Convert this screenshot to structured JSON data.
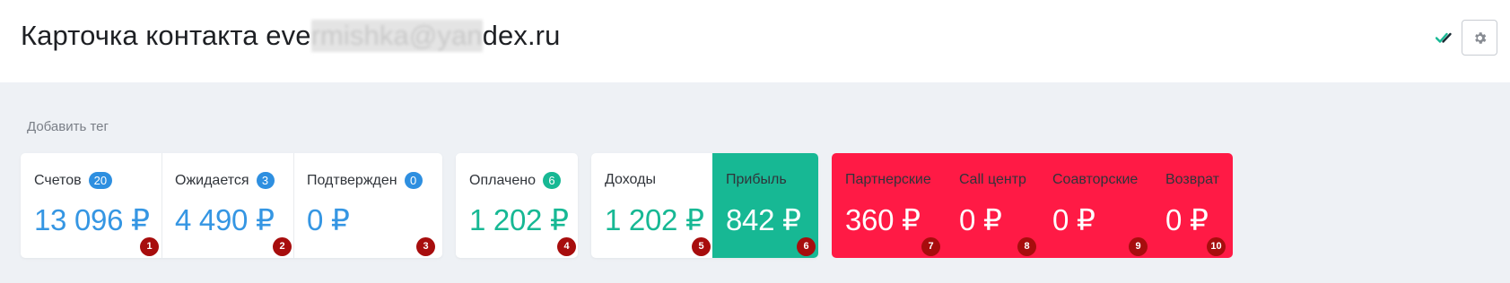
{
  "header": {
    "title_prefix": "Карточка контакта eve",
    "title_masked": "rmishka@yan",
    "title_suffix": "dex.ru",
    "status_icon": "check-double-icon",
    "settings_icon": "gear-icon"
  },
  "add_tag_label": "Добавить тег",
  "colors": {
    "blue": "#3596e3",
    "green": "#17b894",
    "red": "#ff1a45",
    "marker": "#a70d0d"
  },
  "stats": {
    "invoices": {
      "label": "Счетов",
      "badge": "20",
      "value": "13 096 ₽",
      "marker": "1"
    },
    "expected": {
      "label": "Ожидается",
      "badge": "3",
      "value": "4 490 ₽",
      "marker": "2"
    },
    "confirmed": {
      "label": "Подтвержден",
      "badge": "0",
      "value": "0 ₽",
      "marker": "3"
    },
    "paid": {
      "label": "Оплачено",
      "badge": "6",
      "value": "1 202 ₽",
      "marker": "4"
    },
    "income": {
      "label": "Доходы",
      "value": "1 202 ₽",
      "marker": "5"
    },
    "profit": {
      "label": "Прибыль",
      "value": "842 ₽",
      "marker": "6"
    },
    "partner": {
      "label": "Партнерские",
      "value": "360 ₽",
      "marker": "7"
    },
    "call_center": {
      "label": "Call центр",
      "value": "0 ₽",
      "marker": "8"
    },
    "coauthor": {
      "label": "Соавторские",
      "value": "0 ₽",
      "marker": "9"
    },
    "refund": {
      "label": "Возврат",
      "value": "0 ₽",
      "marker": "10"
    }
  }
}
